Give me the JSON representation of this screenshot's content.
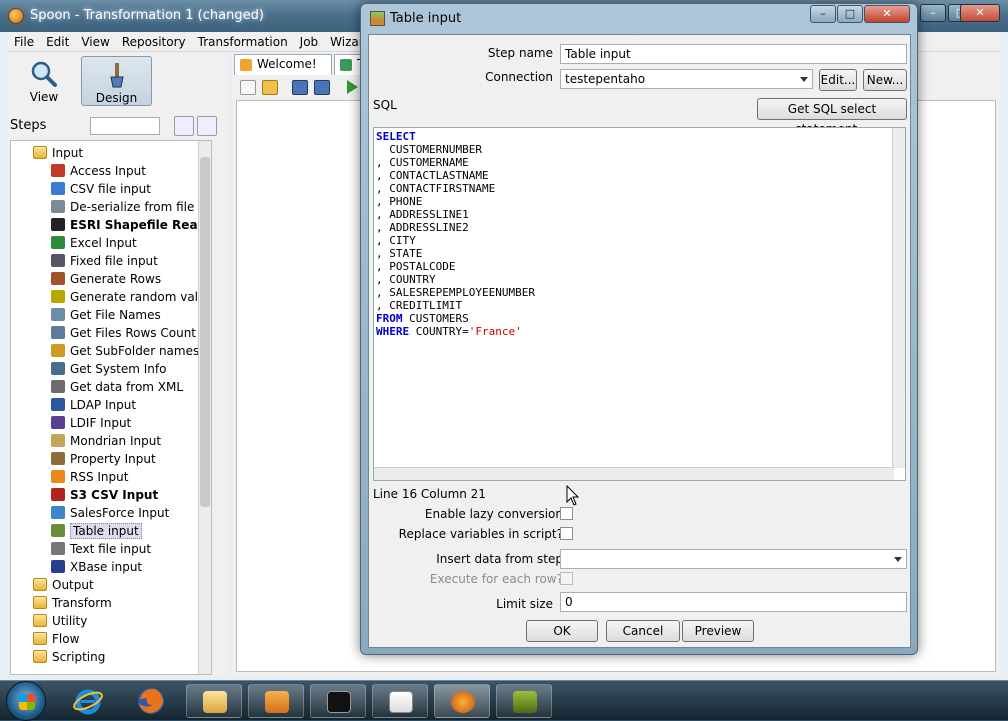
{
  "main_window": {
    "title": "Spoon - Transformation 1 (changed)",
    "controls": {
      "minimize": "–",
      "maximize": "□",
      "close": "✕"
    }
  },
  "menu": [
    "File",
    "Edit",
    "View",
    "Repository",
    "Transformation",
    "Job",
    "Wizard"
  ],
  "perspectives": [
    {
      "label": "View",
      "icon": "magnifier-icon"
    },
    {
      "label": "Design",
      "icon": "paintbrush-icon",
      "active": true
    }
  ],
  "steps": {
    "label": "Steps",
    "search_value": ""
  },
  "tabs": [
    {
      "label": "Welcome!",
      "icon": "welcome-icon"
    },
    {
      "label": "T",
      "icon": "transformation-icon"
    }
  ],
  "tree": {
    "categories": [
      {
        "label": "Input",
        "expanded": true
      },
      {
        "label": "Output"
      },
      {
        "label": "Transform"
      },
      {
        "label": "Utility"
      },
      {
        "label": "Flow"
      },
      {
        "label": "Scripting"
      }
    ],
    "input_steps": [
      "Access Input",
      "CSV file input",
      "De-serialize from file",
      "ESRI Shapefile Reader",
      "Excel Input",
      "Fixed file input",
      "Generate Rows",
      "Generate random value",
      "Get File Names",
      "Get Files Rows Count",
      "Get SubFolder names",
      "Get System Info",
      "Get data from XML",
      "LDAP Input",
      "LDIF Input",
      "Mondrian Input",
      "Property Input",
      "RSS Input",
      "S3 CSV Input",
      "SalesForce Input",
      "Table input",
      "Text file input",
      "XBase input"
    ],
    "bold_steps": [
      "ESRI Shapefile Reader",
      "S3 CSV Input"
    ],
    "selected_step": "Table input"
  },
  "dialog": {
    "title": "Table input",
    "controls": {
      "minimize": "–",
      "maximize": "□",
      "close": "✕"
    },
    "step_name_label": "Step name",
    "step_name_value": "Table input",
    "connection_label": "Connection",
    "connection_value": "testepentaho",
    "edit_button": "Edit...",
    "new_button": "New...",
    "sql_label": "SQL",
    "get_sql_button": "Get SQL select statement...",
    "sql_text": {
      "select_kw": "SELECT",
      "columns": [
        "  CUSTOMERNUMBER",
        ", CUSTOMERNAME",
        ", CONTACTLASTNAME",
        ", CONTACTFIRSTNAME",
        ", PHONE",
        ", ADDRESSLINE1",
        ", ADDRESSLINE2",
        ", CITY",
        ", STATE",
        ", POSTALCODE",
        ", COUNTRY",
        ", SALESREPEMPLOYEENUMBER",
        ", CREDITLIMIT"
      ],
      "from_kw": "FROM",
      "from_table": " CUSTOMERS",
      "where_kw": "WHERE",
      "where_clause": " COUNTRY=",
      "where_value": "'France'"
    },
    "position_status": "Line 16 Column 21",
    "lazy_conversion_label": "Enable lazy conversion",
    "lazy_conversion_checked": false,
    "replace_variables_label": "Replace variables in script?",
    "replace_variables_checked": false,
    "insert_data_label": "Insert data from step",
    "insert_data_value": "",
    "execute_each_row_label": "Execute for each row?",
    "execute_each_row_checked": false,
    "limit_size_label": "Limit size",
    "limit_size_value": "0",
    "ok_button": "OK",
    "cancel_button": "Cancel",
    "preview_button": "Preview"
  },
  "taskbar": {
    "items": [
      "windows-start-icon",
      "internet-explorer-icon",
      "firefox-icon",
      "file-explorer-icon",
      "media-player-icon",
      "command-prompt-icon",
      "java-icon",
      "spoon-app-icon",
      "camtasia-icon"
    ]
  }
}
